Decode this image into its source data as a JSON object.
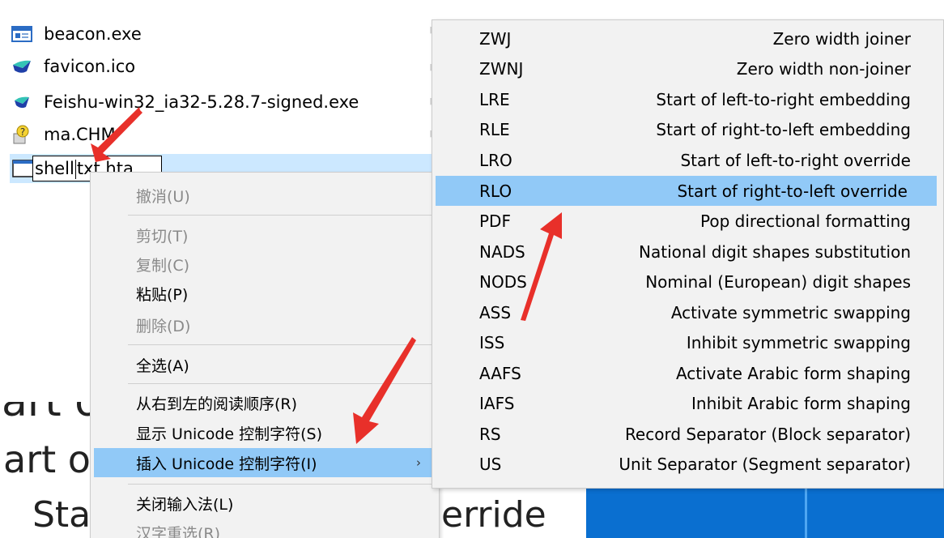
{
  "files": [
    {
      "name": "beacon.exe",
      "icon": "exe-window-icon"
    },
    {
      "name": "favicon.ico",
      "icon": "feishu-logo-icon"
    },
    {
      "name": "Feishu-win32_ia32-5.28.7-signed.exe",
      "icon": "feishu-logo-icon"
    },
    {
      "name": "ma.CHM",
      "icon": "chm-help-icon"
    }
  ],
  "rename": {
    "icon": "hta-window-icon",
    "before_caret": "shell",
    "after_caret": "txt.hta"
  },
  "background": {
    "line1": "art o",
    "line2": "art of",
    "line3": "Sta",
    "line4": "erride"
  },
  "context_menu": {
    "items": [
      {
        "label": "撤消(U)",
        "disabled": true
      },
      {
        "label": "剪切(T)",
        "disabled": true
      },
      {
        "label": "复制(C)",
        "disabled": true
      },
      {
        "label": "粘贴(P)",
        "disabled": false
      },
      {
        "label": "删除(D)",
        "disabled": true
      },
      {
        "label": "全选(A)",
        "disabled": false
      },
      {
        "label": "从右到左的阅读顺序(R)",
        "disabled": false
      },
      {
        "label": "显示 Unicode 控制字符(S)",
        "disabled": false
      },
      {
        "label": "插入 Unicode 控制字符(I)",
        "disabled": false,
        "has_submenu": true,
        "submenu_arrow": "›"
      },
      {
        "label": "关闭输入法(L)",
        "disabled": false
      },
      {
        "label": "汉字重选(R)",
        "disabled": true
      }
    ]
  },
  "unicode_submenu": {
    "items": [
      {
        "code": "ZWJ",
        "desc": "Zero width joiner"
      },
      {
        "code": "ZWNJ",
        "desc": "Zero width non-joiner"
      },
      {
        "code": "LRE",
        "desc": "Start of left-to-right embedding"
      },
      {
        "code": "RLE",
        "desc": "Start of right-to-left embedding"
      },
      {
        "code": "LRO",
        "desc": "Start of left-to-right override"
      },
      {
        "code": "RLO",
        "desc": "Start of right-to-left override"
      },
      {
        "code": "PDF",
        "desc": "Pop directional formatting"
      },
      {
        "code": "NADS",
        "desc": "National digit shapes substitution"
      },
      {
        "code": "NODS",
        "desc": "Nominal (European) digit shapes"
      },
      {
        "code": "ASS",
        "desc": "Activate symmetric swapping"
      },
      {
        "code": "ISS",
        "desc": "Inhibit symmetric swapping"
      },
      {
        "code": "AAFS",
        "desc": "Activate Arabic form shaping"
      },
      {
        "code": "IAFS",
        "desc": "Inhibit Arabic form shaping"
      },
      {
        "code": "RS",
        "desc": "Record Separator (Block separator)"
      },
      {
        "code": "US",
        "desc": "Unit Separator (Segment separator)"
      }
    ],
    "highlighted": "RLO"
  },
  "colors": {
    "highlight": "#91c9f7",
    "selection": "#cce8ff",
    "annotation_arrow": "#e8302a",
    "desktop_blue": "#0a6fd0"
  }
}
